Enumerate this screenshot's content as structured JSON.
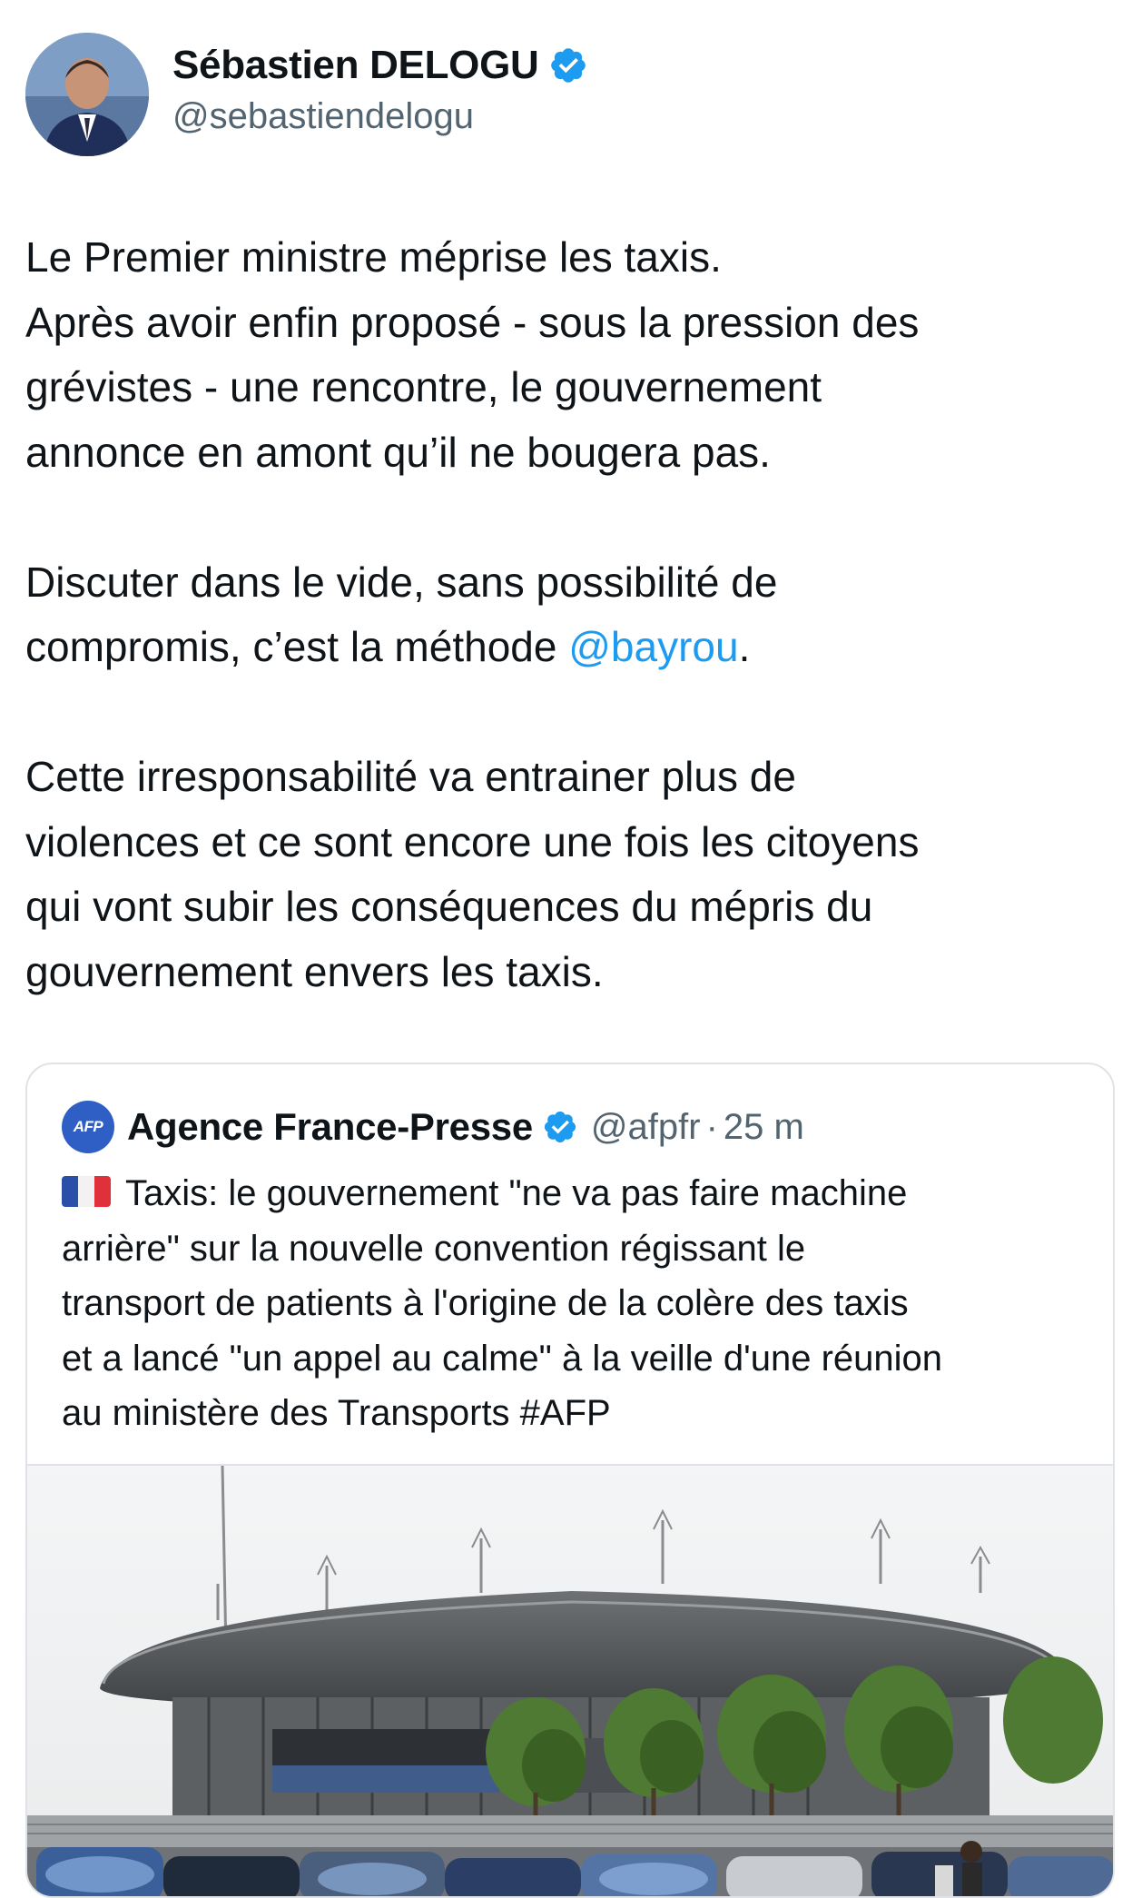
{
  "author": {
    "display_name": "Sébastien DELOGU",
    "handle": "@sebastiendelogu",
    "verified_icon": "verified-badge-icon"
  },
  "tweet": {
    "paragraphs": [
      {
        "lines": [
          "Le Premier ministre méprise les taxis.",
          "Après avoir enfin proposé - sous la pression des",
          "grévistes - une rencontre, le gouvernement",
          "annonce en amont qu’il ne bougera pas."
        ]
      },
      {
        "line1": "Discuter dans le vide, sans possibilité de",
        "line2_prefix": "compromis, c’est la méthode ",
        "mention": "@bayrou",
        "line2_suffix": "."
      },
      {
        "lines": [
          "Cette irresponsabilité va entrainer plus de",
          "violences et ce sont encore une fois les citoyens",
          "qui vont subir les conséquences du mépris du",
          "gouvernement envers les taxis."
        ]
      }
    ]
  },
  "quoted_tweet": {
    "logo_text": "AFP",
    "display_name": "Agence France-Presse",
    "handle": "@afpfr",
    "separator": "·",
    "time": "25 m",
    "flag_icon": "france-flag-icon",
    "lines": [
      "Taxis: le gouvernement \"ne va pas faire machine",
      "arrière\" sur la nouvelle convention régissant le",
      "transport de patients à l'origine de la colère des taxis",
      "et a lancé \"un appel au calme\" à la veille d'une réunion",
      "au ministère des Transports #AFP"
    ]
  },
  "colors": {
    "text": "#0f1419",
    "secondary": "#536471",
    "mention": "#1d9bf0",
    "verified": "#1d9bf0",
    "border": "#dfe3e7",
    "afp_blue": "#2f5fc4"
  }
}
